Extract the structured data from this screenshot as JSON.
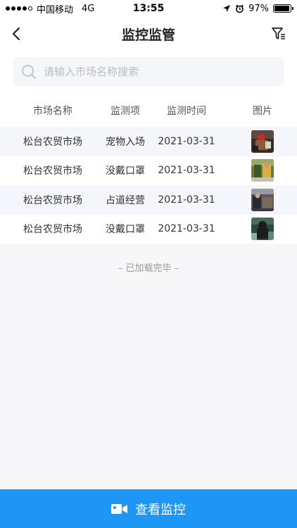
{
  "status_bar": {
    "carrier": "中国移动",
    "network": "4G",
    "time": "13:55",
    "battery_percent": "97%",
    "battery_level": 0.97
  },
  "nav": {
    "title": "监控监管",
    "back_icon": "chevron-left-icon",
    "filter_icon": "filter-icon"
  },
  "search": {
    "placeholder": "请输入市场名称搜索",
    "value": ""
  },
  "table": {
    "headers": [
      "市场名称",
      "监测项",
      "监测时间",
      "图片"
    ],
    "rows": [
      {
        "market": "松台农贸市场",
        "item": "宠物入场",
        "time": "2021-03-31",
        "image": "thumbnail"
      },
      {
        "market": "松台农贸市场",
        "item": "没戴口罩",
        "time": "2021-03-31",
        "image": "thumbnail"
      },
      {
        "market": "松台农贸市场",
        "item": "占道经营",
        "time": "2021-03-31",
        "image": "thumbnail"
      },
      {
        "market": "松台农贸市场",
        "item": "没戴口罩",
        "time": "2021-03-31",
        "image": "thumbnail"
      }
    ]
  },
  "footer": {
    "loaded_text": "– 已加载完毕 –"
  },
  "bottom_button": {
    "label": "查看监控",
    "icon": "video-camera-icon"
  },
  "colors": {
    "accent": "#1e96f5",
    "alt_row": "#f4f6fb",
    "background": "#f7f7f9"
  }
}
